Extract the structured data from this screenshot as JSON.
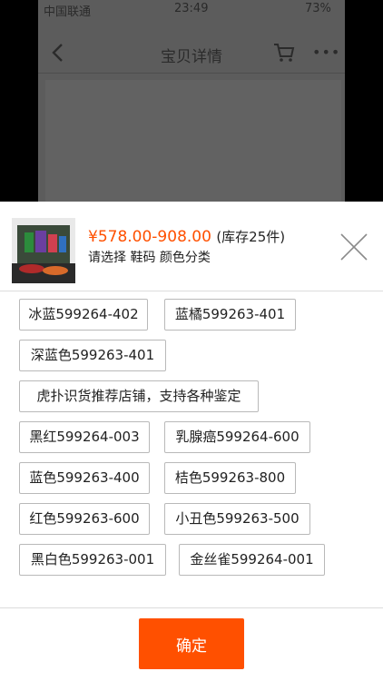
{
  "status_bar": {
    "carrier": "中国联通",
    "time": "23:49",
    "battery": "73%"
  },
  "nav": {
    "title": "宝贝详情",
    "more_label": "•••"
  },
  "sheet": {
    "price": "¥578.00-908.00",
    "stock": "(库存25件)",
    "hint": "请选择 鞋码 颜色分类",
    "options": [
      "冰蓝599264-402",
      "蓝橘599263-401",
      "深蓝色599263-401",
      "虎扑识货推荐店铺，支持各种鉴定",
      "黑红599264-003",
      "乳腺癌599264-600",
      "蓝色599263-400",
      "桔色599263-800",
      "红色599263-600",
      "小丑色599263-500",
      "黑白色599263-001",
      "金丝雀599264-001"
    ],
    "confirm_label": "确定"
  },
  "colors": {
    "accent": "#ff5000",
    "border": "#b9b9b9"
  }
}
